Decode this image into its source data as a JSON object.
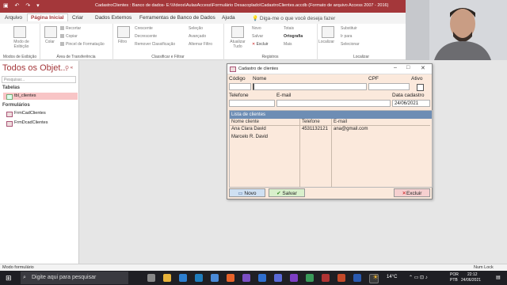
{
  "window": {
    "title": "CadastroClientes : Banco de dados- E:\\Videos\\AulasAccess\\Formulário Desacoplado\\CadastroClientes.accdb (Formato de arquivo Access 2007 - 2016)"
  },
  "ribbon": {
    "tabs": [
      "Arquivo",
      "Página Inicial",
      "Criar",
      "Dados Externos",
      "Ferramentas de Banco de Dados",
      "Ajuda"
    ],
    "search_placeholder": "Diga-me o que você deseja fazer",
    "groups": {
      "views": {
        "label": "Modos de Exibição",
        "btn": "Modo de Exibição"
      },
      "clipboard": {
        "label": "Área de Transferência",
        "paste": "Colar",
        "cut": "Recortar",
        "copy": "Copiar",
        "format": "Pincel de Formatação"
      },
      "sortfilter": {
        "label": "Classificar e Filtrar",
        "filter": "Filtro",
        "asc": "Crescente",
        "desc": "Decrescente",
        "remove": "Remover Classificação",
        "selection": "Seleção",
        "advanced": "Avançado",
        "toggle": "Alternar Filtro"
      },
      "records": {
        "label": "Registros",
        "refresh": "Atualizar Tudo",
        "new": "Novo",
        "save": "Salvar",
        "delete": "Excluir",
        "totals": "Totais",
        "spelling": "Ortografia",
        "more": "Mais"
      },
      "find": {
        "label": "Localizar",
        "find": "Localizar",
        "replace": "Substituir",
        "goto": "Ir para",
        "select": "Selecionar"
      }
    }
  },
  "nav": {
    "title": "Todos os Objet...",
    "search_placeholder": "Pesquisar...",
    "sections": [
      {
        "label": "Tabelas",
        "items": [
          "tbl_clientes"
        ]
      },
      {
        "label": "Formulários",
        "items": [
          "FrmCadClientes",
          "FrmDcadClientes"
        ]
      }
    ]
  },
  "dialog": {
    "title": "Cadastro de clientes",
    "labels": {
      "codigo": "Código",
      "nome": "Nome",
      "cpf": "CPF",
      "ativo": "Ativo",
      "telefone": "Telefone",
      "email": "E-mail",
      "data": "Data cadastro"
    },
    "values": {
      "codigo": "",
      "nome": "",
      "cpf": "",
      "telefone": "",
      "email": "",
      "data": "24/06/2021"
    },
    "list": {
      "header": "Lista de clientes",
      "columns": [
        "Nome cliente",
        "Telefone",
        "E-mail"
      ],
      "rows": [
        [
          "Ana Clara David",
          "4531132121",
          "ana@gmail.com"
        ],
        [
          "Marcelo R. David",
          "",
          ""
        ]
      ]
    },
    "buttons": {
      "novo": "Novo",
      "salvar": "Salvar",
      "excluir": "Excluir"
    }
  },
  "status": {
    "left": "Modo formulário",
    "right": "Num Lock"
  },
  "taskbar": {
    "search_placeholder": "Digite aqui para pesquisar",
    "temperature": "14°C",
    "lang1": "POR",
    "lang2": "PTB",
    "time": "22:12",
    "date": "24/06/2021"
  }
}
